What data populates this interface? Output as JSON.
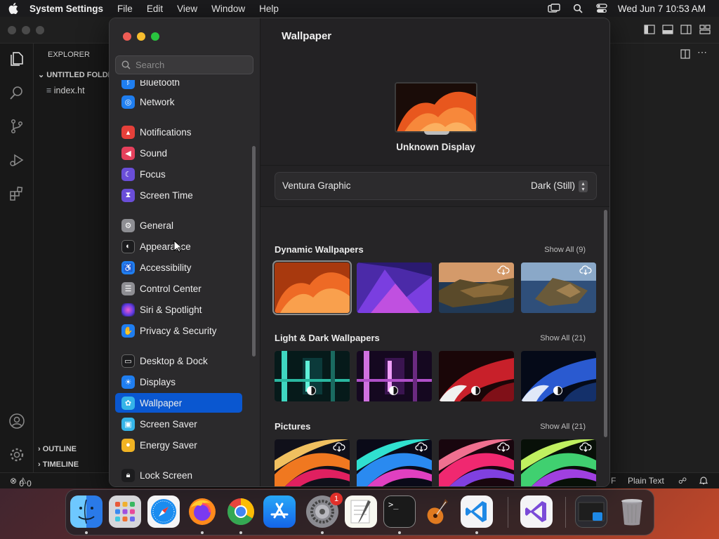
{
  "menubar": {
    "app_name": "System Settings",
    "menus": [
      "File",
      "Edit",
      "View",
      "Window",
      "Help"
    ],
    "clock": "Wed Jun 7  10:53 AM",
    "status_icons": [
      "screen-mirroring-icon",
      "spotlight-search-icon",
      "control-center-icon"
    ]
  },
  "vscode": {
    "explorer_title": "EXPLORER",
    "folder_name": "UNTITLED FOLDER",
    "file_name": "index.ht",
    "outline_label": "OUTLINE",
    "timeline_label": "TIMELINE",
    "status_errors": "0",
    "status_warnings": "0",
    "status_language": "Plain Text",
    "status_right_fragment": "F"
  },
  "settings": {
    "search_placeholder": "Search",
    "sidebar": [
      {
        "label": "Bluetooth",
        "icon": "bluetooth-icon",
        "color": "#1f7ef0"
      },
      {
        "label": "Network",
        "icon": "globe-icon",
        "color": "#1f7ef0"
      },
      {
        "label": "Notifications",
        "icon": "bell-icon",
        "color": "#e5403a"
      },
      {
        "label": "Sound",
        "icon": "speaker-icon",
        "color": "#e5405c"
      },
      {
        "label": "Focus",
        "icon": "moon-icon",
        "color": "#6a4ed8"
      },
      {
        "label": "Screen Time",
        "icon": "hourglass-icon",
        "color": "#6a4ed8"
      },
      {
        "label": "General",
        "icon": "gear-icon",
        "color": "#8e8e93"
      },
      {
        "label": "Appearance",
        "icon": "appearance-icon",
        "color": "#1c1c1e"
      },
      {
        "label": "Accessibility",
        "icon": "accessibility-icon",
        "color": "#1f7ef0"
      },
      {
        "label": "Control Center",
        "icon": "toggles-icon",
        "color": "#8e8e93"
      },
      {
        "label": "Siri & Spotlight",
        "icon": "siri-icon",
        "color": "#b8339b"
      },
      {
        "label": "Privacy & Security",
        "icon": "hand-icon",
        "color": "#1f7ef0"
      },
      {
        "label": "Desktop & Dock",
        "icon": "dock-icon",
        "color": "#1c1c1e"
      },
      {
        "label": "Displays",
        "icon": "sun-icon",
        "color": "#1f7ef0"
      },
      {
        "label": "Wallpaper",
        "icon": "flower-icon",
        "color": "#35b4e8"
      },
      {
        "label": "Screen Saver",
        "icon": "screensaver-icon",
        "color": "#35b4e8"
      },
      {
        "label": "Energy Saver",
        "icon": "lightbulb-icon",
        "color": "#f0b323"
      },
      {
        "label": "Lock Screen",
        "icon": "lock-icon",
        "color": "#1c1c1e"
      }
    ],
    "selected_item": "Wallpaper",
    "pane": {
      "title": "Wallpaper",
      "display_name": "Unknown Display",
      "wallpaper_name": "Ventura Graphic",
      "wallpaper_mode": "Dark (Still)",
      "sections": [
        {
          "title": "Dynamic Wallpapers",
          "show_all": "Show All (9)",
          "thumbs": [
            "Ventura orange",
            "Monterey purple",
            "Catalina coast",
            "Catalina island"
          ]
        },
        {
          "title": "Light & Dark Wallpapers",
          "show_all": "Show All (21)",
          "thumbs": [
            "Teal glass",
            "Purple glass",
            "Red waves",
            "Blue waves"
          ]
        },
        {
          "title": "Pictures",
          "show_all": "Show All (21)",
          "thumbs": [
            "Orange swirl",
            "Blue swirl",
            "Pink swirl",
            "Green swirl"
          ]
        }
      ]
    }
  },
  "dock": {
    "apps": [
      "Finder",
      "Launchpad",
      "Safari",
      "Firefox",
      "Chrome",
      "App Store",
      "System Settings",
      "TextEdit",
      "Terminal",
      "GarageBand",
      "Visual Studio Code",
      "Visual Studio"
    ],
    "settings_badge": "1",
    "right_items": [
      "Recent Window",
      "Trash"
    ]
  }
}
